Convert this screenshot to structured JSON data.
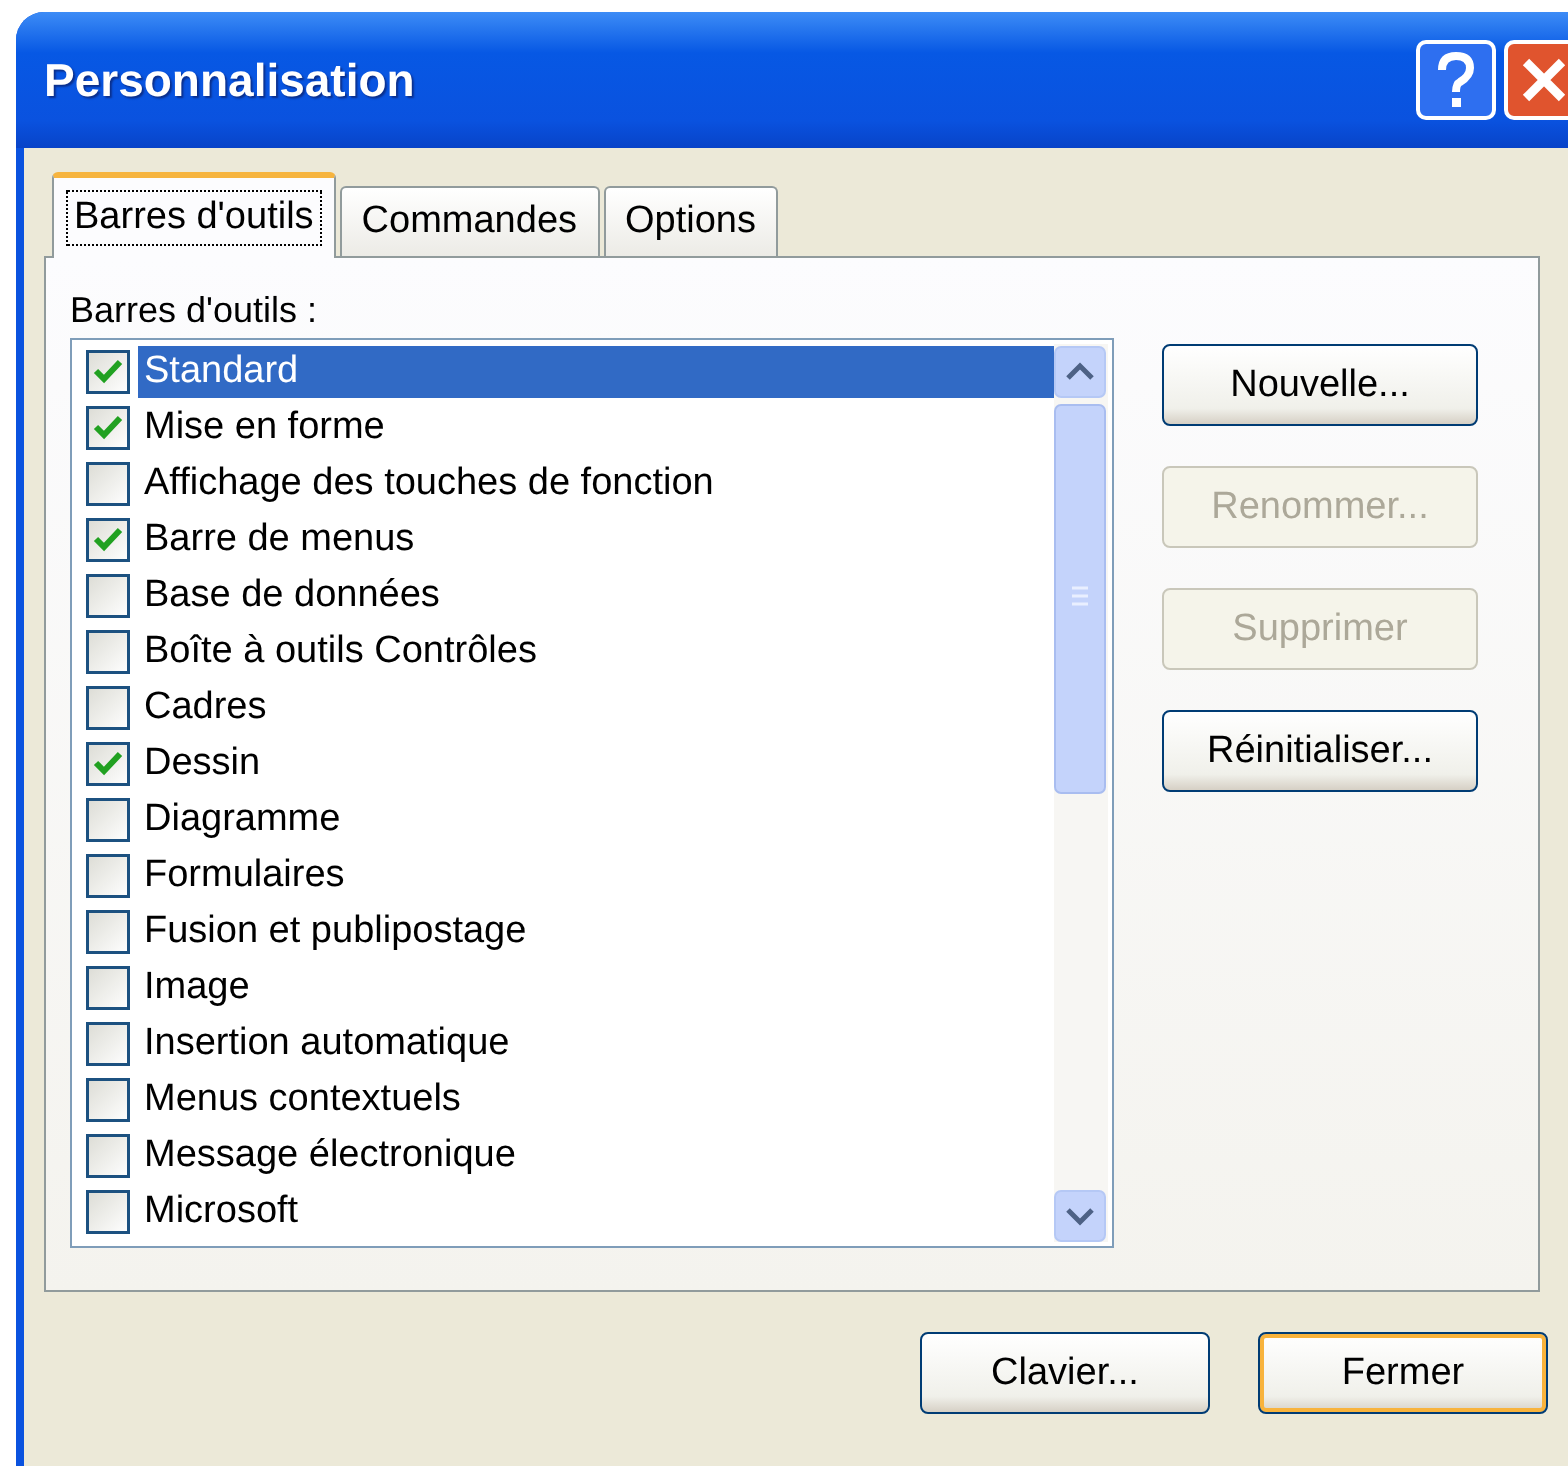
{
  "window": {
    "title": "Personnalisation"
  },
  "tabs": [
    {
      "label": "Barres d'outils",
      "selected": true
    },
    {
      "label": "Commandes",
      "selected": false
    },
    {
      "label": "Options",
      "selected": false
    }
  ],
  "list_label": "Barres d'outils :",
  "toolbars": [
    {
      "label": "Standard",
      "checked": true,
      "selected": true
    },
    {
      "label": "Mise en forme",
      "checked": true,
      "selected": false
    },
    {
      "label": "Affichage des touches de fonction",
      "checked": false,
      "selected": false
    },
    {
      "label": "Barre de menus",
      "checked": true,
      "selected": false
    },
    {
      "label": "Base de données",
      "checked": false,
      "selected": false
    },
    {
      "label": "Boîte à outils Contrôles",
      "checked": false,
      "selected": false
    },
    {
      "label": "Cadres",
      "checked": false,
      "selected": false
    },
    {
      "label": "Dessin",
      "checked": true,
      "selected": false
    },
    {
      "label": "Diagramme",
      "checked": false,
      "selected": false
    },
    {
      "label": "Formulaires",
      "checked": false,
      "selected": false
    },
    {
      "label": "Fusion et publipostage",
      "checked": false,
      "selected": false
    },
    {
      "label": "Image",
      "checked": false,
      "selected": false
    },
    {
      "label": "Insertion automatique",
      "checked": false,
      "selected": false
    },
    {
      "label": "Menus contextuels",
      "checked": false,
      "selected": false
    },
    {
      "label": "Message électronique",
      "checked": false,
      "selected": false
    },
    {
      "label": "Microsoft",
      "checked": false,
      "selected": false
    }
  ],
  "side_buttons": [
    {
      "label": "Nouvelle...",
      "disabled": false
    },
    {
      "label": "Renommer...",
      "disabled": true
    },
    {
      "label": "Supprimer",
      "disabled": true
    },
    {
      "label": "Réinitialiser...",
      "disabled": false
    }
  ],
  "footer_buttons": [
    {
      "label": "Clavier...",
      "default": false
    },
    {
      "label": "Fermer",
      "default": true
    }
  ]
}
